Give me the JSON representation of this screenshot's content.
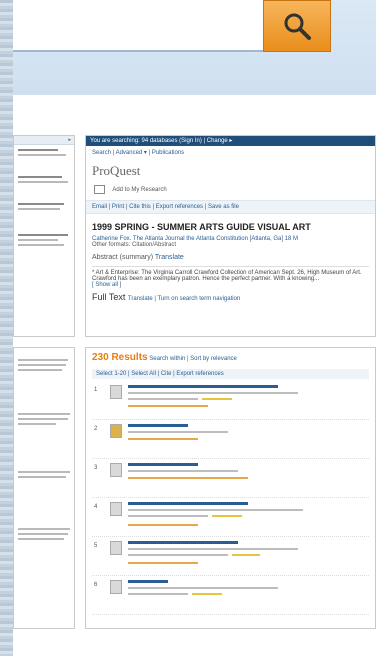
{
  "search": {
    "button_icon": "search-icon"
  },
  "proquest": {
    "topbar": "You are searching: 94 databases (Sign In) | Change ▸",
    "nav": "Search | Advanced ▾ | Publications",
    "logo": "ProQuest",
    "add_to_research": "Add to My Research",
    "tools": "Email | Print | Cite this | Export references | Save as file",
    "title": "1999 SPRING - SUMMER ARTS GUIDE VISUAL ART",
    "byline": "Catherine Fox. The Atlanta Journal the Atlanta Constitution [Atlanta, Ga] 18 M",
    "other_formats": "Other formats: Citation/Abstract",
    "abstract_label": "Abstract (summary)",
    "translate": "Translate",
    "abstract_text": "* Art & Enterprise: The Virginia Carroll Crawford Collection of American Sept. 26, High Museum of Art. Crawford has been an exemplary patron. Hence the perfect partner. With a knowing...",
    "show_all": "[ Show all ]",
    "full_text": "Full Text",
    "full_text_links": "Translate | Turn on search term navigation"
  },
  "results": {
    "count": "230 Results",
    "links": "Search within | Sort by relevance",
    "tools": "Select 1-20 | Select All | Cite | Export references",
    "item_numbers": [
      "1",
      "2",
      "3",
      "4",
      "5",
      "6"
    ]
  }
}
